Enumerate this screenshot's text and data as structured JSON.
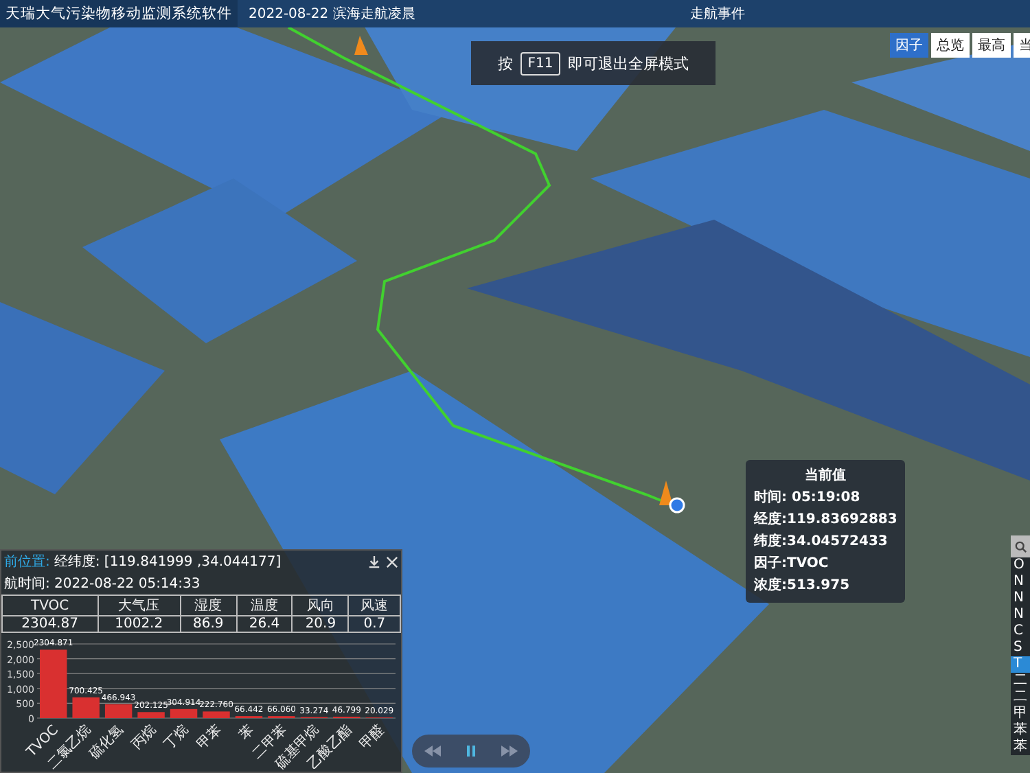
{
  "header": {
    "title": "天瑞大气污染物移动监测系统软件",
    "date_site": "2022-08-22 滨海走航凌晨",
    "center_label": "走航事件"
  },
  "view_tabs": [
    {
      "label": "因子",
      "selected": true
    },
    {
      "label": "总览",
      "selected": false
    },
    {
      "label": "最高",
      "selected": false
    },
    {
      "label": "当",
      "selected": false
    }
  ],
  "fullscreen_hint": {
    "prefix": "按",
    "key": "F11",
    "message": "即可退出全屏模式"
  },
  "current_value_popup": {
    "title": "当前值",
    "lines": [
      "时间: 05:19:08",
      "经度:119.83692883",
      "纬度:34.04572433",
      "因子:TVOC",
      "浓度:513.975"
    ]
  },
  "data_panel": {
    "position_label": "前位置:",
    "position_value": "经纬度: [119.841999 ,34.044177]",
    "time_line": "航时间: 2022-08-22 05:14:33",
    "table": {
      "columns": [
        "TVOC",
        "大气压",
        "湿度",
        "温度",
        "风向",
        "风速"
      ],
      "rows": [
        [
          "2304.87",
          "1002.2",
          "86.9",
          "26.4",
          "20.9",
          "0.7"
        ]
      ]
    },
    "chart_data": {
      "type": "bar",
      "categories": [
        "TVOC",
        "二氯乙烷",
        "硫化氢",
        "丙烷",
        "丁烷",
        "甲苯",
        "苯",
        "二甲苯",
        "硫基甲烷",
        "乙酸乙酯",
        "甲醛"
      ],
      "values": [
        2304.871,
        700.425,
        466.943,
        202.125,
        304.914,
        222.76,
        66.442,
        66.06,
        33.274,
        46.799,
        20.029
      ],
      "ylim": [
        0,
        2500
      ],
      "yticks": [
        0,
        500,
        {
          "value": 1000,
          "label": "1,000"
        },
        {
          "value": 1500,
          "label": "1,500"
        },
        {
          "value": 2000,
          "label": "2,000"
        },
        {
          "value": 2500,
          "label": "2,500"
        }
      ],
      "grid": true,
      "value_labels": [
        "2304.871",
        "700.425",
        "466.943",
        "202.125",
        "304.914",
        "222.760",
        "66.442",
        "66.060",
        "33.274",
        "46.799",
        "20.029"
      ]
    }
  },
  "side_list": {
    "items": [
      {
        "label": "O",
        "selected": false
      },
      {
        "label": "N",
        "selected": false
      },
      {
        "label": "N",
        "selected": false
      },
      {
        "label": "N",
        "selected": false
      },
      {
        "label": "C",
        "selected": false
      },
      {
        "label": "S",
        "selected": false
      },
      {
        "label": "T",
        "selected": true
      },
      {
        "label": "二",
        "selected": false
      },
      {
        "label": "二",
        "selected": false
      },
      {
        "label": "甲",
        "selected": false
      },
      {
        "label": "苯",
        "selected": false
      },
      {
        "label": "苯",
        "selected": false
      }
    ]
  }
}
